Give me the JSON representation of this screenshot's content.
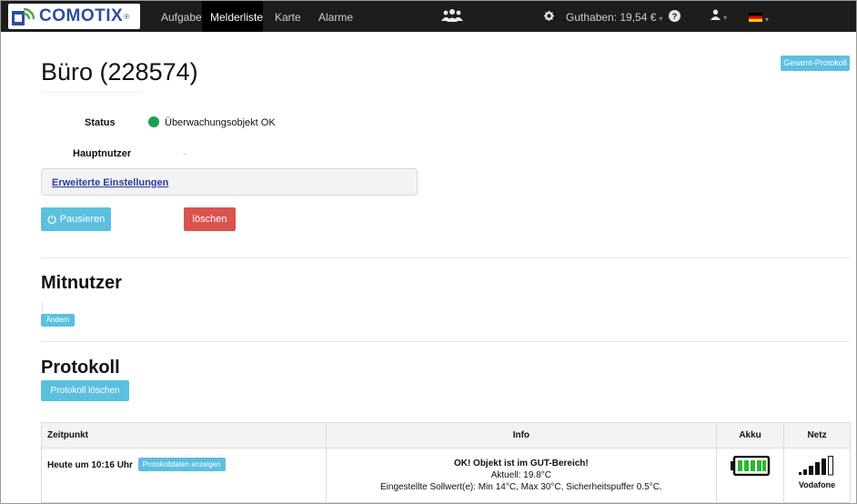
{
  "nav": {
    "brand": "COMOTIX",
    "brand_mark": "®",
    "items": [
      {
        "label": "Aufgaben"
      },
      {
        "label": "Melderliste",
        "active": true
      },
      {
        "label": "Karte"
      },
      {
        "label": "Alarme"
      }
    ],
    "users_icon": "users-icon",
    "settings_icon": "gear-icon",
    "balance": "Guthaben: 19,54 €",
    "help_icon": "question-circle-icon",
    "user_icon": "user-icon",
    "language_icon": "german-flag-icon"
  },
  "page": {
    "title": "Büro (228574)",
    "full_log_button": "Gesamt-Protokoll",
    "status_label": "Status",
    "status_value": "Überwachungsobjekt OK",
    "status_color": "#1f9d4d",
    "main_user_label": "Hauptnutzer",
    "main_user_value": "-",
    "advanced_settings": "Erweiterte Einstellungen",
    "pause_button": "Pausieren",
    "delete_button": "löschen"
  },
  "co_users": {
    "title": "Mitnutzer",
    "change_button": "Ändern"
  },
  "log": {
    "title": "Protokoll",
    "clear_button": "Protokoll löschen",
    "columns": [
      "Zeitpunkt",
      "Info",
      "Akku",
      "Netz"
    ],
    "rows": [
      {
        "time": "Heute um 10:16 Uhr",
        "show_data_button": "Protokolldaten anzeigen",
        "info_title": "OK! Objekt ist im GUT-Bereich!",
        "info_current": "Aktuell: 19.8°C",
        "info_setpoints": "Eingestellte Sollwert(e): Min 14°C, Max 30°C, Sicherheitspuffer 0.5°C.",
        "battery_level": 1.0,
        "battery_color": "#2fb52f",
        "signal_bars": 4,
        "network": "Vodafone"
      }
    ]
  },
  "colors": {
    "info": "#5bc0de",
    "danger": "#d9534f",
    "navbar": "#1d1d1d",
    "link": "#2a3c9a"
  }
}
